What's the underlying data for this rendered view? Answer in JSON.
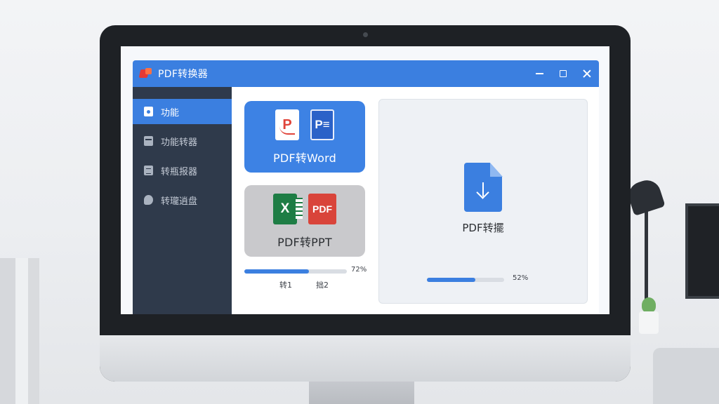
{
  "window": {
    "title": "PDF转换器"
  },
  "sidebar": {
    "items": [
      {
        "label": "功能",
        "active": true
      },
      {
        "label": "功能转器"
      },
      {
        "label": "转瓶报器"
      },
      {
        "label": "转瓏逍盘"
      }
    ]
  },
  "cards": {
    "word": {
      "label": "PDF转Word",
      "icon_left": "P",
      "icon_right": "P≡"
    },
    "ppt": {
      "label": "PDF转PPT",
      "icon_left": "X",
      "icon_right": "PDF"
    }
  },
  "progress_left": {
    "percent_label": "72%",
    "percent": 0.63,
    "steps": [
      "转1",
      "拙2"
    ]
  },
  "drop_panel": {
    "label": "PDF转擺",
    "percent_label": "52%",
    "percent": 0.63
  },
  "colors": {
    "accent": "#3b7fe0",
    "sidebar": "#2f3a4b"
  }
}
